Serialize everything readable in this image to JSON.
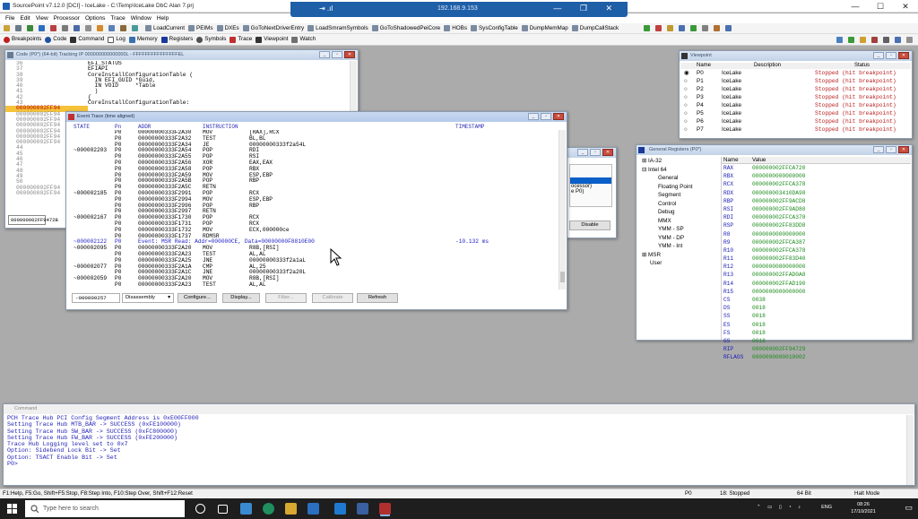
{
  "app": {
    "title": "SourcePoint v7.12.0 [DCI] - IceLake - C:\\Temp\\IceLake DbC Alan 7.prj",
    "controls": [
      "—",
      "☐",
      "✕"
    ]
  },
  "remote": {
    "host": "192.168.9.153",
    "signal": "⇥ .ıl",
    "controls": "— ❐ ✕"
  },
  "menu": [
    "File",
    "Edit",
    "View",
    "Processor",
    "Options",
    "Trace",
    "Window",
    "Help"
  ],
  "toolbar1": {
    "macros": [
      "LoadCurrent",
      "PEIMs",
      "DXEs",
      "GoToNextDriverEntry",
      "LoadSmramSymbols",
      "GoToShadowedPeiCore",
      "HOBs",
      "SysConfigTable",
      "DumpMemMap",
      "DumpCallStack"
    ]
  },
  "toolbar2": {
    "views": [
      "Breakpoints",
      "Code",
      "Command",
      "Log",
      "Memory",
      "Registers",
      "Symbols",
      "Trace",
      "Viewpoint",
      "Watch"
    ]
  },
  "code_window": {
    "title": "Code (P0*) (64-bit) Tracking IP 000000000000000L - FFFFFFFFFFFFFFFEL",
    "lines": [
      {
        "n": "36",
        "t": "EFI_STATUS"
      },
      {
        "n": "37",
        "t": "EFIAPI"
      },
      {
        "n": "38",
        "t": "CoreInstallConfigurationTable ("
      },
      {
        "n": "39",
        "t": "  IN EFI_GUID *Guid,"
      },
      {
        "n": "40",
        "t": "  IN VOID     *Table"
      },
      {
        "n": "41",
        "t": "  )"
      },
      {
        "n": "42",
        "t": "{"
      },
      {
        "n": "43",
        "t": "CoreInstallConfigurationTable:"
      },
      {
        "n": "000000002FF94",
        "t": "",
        "cur": true
      },
      {
        "n": "000000002FF94",
        "t": "",
        "addr": true
      },
      {
        "n": "000000002FF94",
        "t": "",
        "addr": true
      },
      {
        "n": "000000002FF94",
        "t": "",
        "addr": true
      },
      {
        "n": "000000002FF94",
        "t": "",
        "addr": true
      },
      {
        "n": "000000002FF94",
        "t": "",
        "addr": true
      },
      {
        "n": "000000002FF94",
        "t": "",
        "addr": true
      },
      {
        "n": "44",
        "t": ""
      },
      {
        "n": "45",
        "t": ""
      },
      {
        "n": "46",
        "t": ""
      },
      {
        "n": "47",
        "t": ""
      },
      {
        "n": "48",
        "t": ""
      },
      {
        "n": "49",
        "t": ""
      },
      {
        "n": "50",
        "t": ""
      },
      {
        "n": "000000002FF94",
        "t": "",
        "addr": true
      },
      {
        "n": "000000002FF94",
        "t": "",
        "addr": true
      }
    ],
    "address_box": "000000002FF9472B"
  },
  "trace_window": {
    "title": "Event Trace (time aligned)",
    "headers": {
      "state": "STATE",
      "pn": "Pn",
      "addr": "ADDR",
      "instr": "INSTRUCTION",
      "ts": "TIMESTAMP"
    },
    "rows": [
      {
        "s": "",
        "p": "P0",
        "a": "00000000333F2A30",
        "m": "MOV",
        "o": "[RAX],RCX",
        "t": ""
      },
      {
        "s": "",
        "p": "P0",
        "a": "00000000333F2A32",
        "m": "TEST",
        "o": "BL,BL",
        "t": ""
      },
      {
        "s": "",
        "p": "P0",
        "a": "00000000333F2A34",
        "m": "JE",
        "o": "00000000333f2a54L",
        "t": ""
      },
      {
        "s": "~000002203",
        "p": "P0",
        "a": "00000000333F2A54",
        "m": "POP",
        "o": "RDI",
        "t": ""
      },
      {
        "s": "",
        "p": "P0",
        "a": "00000000333F2A55",
        "m": "POP",
        "o": "RSI",
        "t": ""
      },
      {
        "s": "",
        "p": "P0",
        "a": "00000000333F2A56",
        "m": "XOR",
        "o": "EAX,EAX",
        "t": ""
      },
      {
        "s": "",
        "p": "P0",
        "a": "00000000333F2A58",
        "m": "POP",
        "o": "RBX",
        "t": ""
      },
      {
        "s": "",
        "p": "P0",
        "a": "00000000333F2A59",
        "m": "MOV",
        "o": "ESP,EBP",
        "t": ""
      },
      {
        "s": "",
        "p": "P0",
        "a": "00000000333F2A5B",
        "m": "POP",
        "o": "RBP",
        "t": ""
      },
      {
        "s": "",
        "p": "P0",
        "a": "00000000333F2A5C",
        "m": "RETN",
        "o": "",
        "t": ""
      },
      {
        "s": "~000002185",
        "p": "P0",
        "a": "00000000333F2991",
        "m": "POP",
        "o": "RCX",
        "t": ""
      },
      {
        "s": "",
        "p": "P0",
        "a": "00000000333F2994",
        "m": "MOV",
        "o": "ESP,EBP",
        "t": ""
      },
      {
        "s": "",
        "p": "P0",
        "a": "00000000333F2996",
        "m": "POP",
        "o": "RBP",
        "t": ""
      },
      {
        "s": "",
        "p": "P0",
        "a": "00000000333F2997",
        "m": "RETN",
        "o": "",
        "t": ""
      },
      {
        "s": "~000002167",
        "p": "P0",
        "a": "00000000333F1730",
        "m": "POP",
        "o": "RCX",
        "t": ""
      },
      {
        "s": "",
        "p": "P0",
        "a": "00000000333F1731",
        "m": "POP",
        "o": "RCX",
        "t": ""
      },
      {
        "s": "",
        "p": "P0",
        "a": "00000000333F1732",
        "m": "MOV",
        "o": "ECX,000000ce",
        "t": ""
      },
      {
        "s": "",
        "p": "P0",
        "a": "00000000333F1737",
        "m": "RDMSR",
        "o": "",
        "t": ""
      },
      {
        "s": "~000002122",
        "p": "P0",
        "a": "Event: MSR Read: Addr=000000CE, Data=00000000F8810E00",
        "m": "",
        "o": "",
        "t": "-10.132 ms",
        "ev": true
      },
      {
        "s": "~000002095",
        "p": "P0",
        "a": "00000000333F2A20",
        "m": "MOV",
        "o": "R8B,[RSI]",
        "t": ""
      },
      {
        "s": "",
        "p": "P0",
        "a": "00000000333F2A23",
        "m": "TEST",
        "o": "AL,AL",
        "t": ""
      },
      {
        "s": "",
        "p": "P0",
        "a": "00000000333F2A25",
        "m": "JNE",
        "o": "00000000333f2a1aL",
        "t": ""
      },
      {
        "s": "~000002077",
        "p": "P0",
        "a": "00000000333F2A1A",
        "m": "CMP",
        "o": "AL,25",
        "t": ""
      },
      {
        "s": "",
        "p": "P0",
        "a": "00000000333F2A1C",
        "m": "JNE",
        "o": "00000000333f2a20L",
        "t": ""
      },
      {
        "s": "~000002059",
        "p": "P0",
        "a": "00000000333F2A20",
        "m": "MOV",
        "o": "R8B,[RSI]",
        "t": ""
      },
      {
        "s": "",
        "p": "P0",
        "a": "00000000333F2A23",
        "m": "TEST",
        "o": "AL,AL",
        "t": ""
      }
    ],
    "position": "-000000257",
    "view_select": "Disassembly",
    "buttons": {
      "configure": "Configure...",
      "display": "Display...",
      "filter": "Filter...",
      "calibrate": "Calibrate",
      "refresh": "Refresh"
    }
  },
  "viewpoint_window": {
    "title": "Viewpoint",
    "headers": {
      "name": "Name",
      "desc": "Description",
      "status": "Status"
    },
    "rows": [
      {
        "sel": "◉",
        "name": "P0",
        "desc": "IceLake",
        "status": "Stopped (hit breakpoint)"
      },
      {
        "sel": "○",
        "name": "P1",
        "desc": "IceLake",
        "status": "Stopped (hit breakpoint)"
      },
      {
        "sel": "○",
        "name": "P2",
        "desc": "IceLake",
        "status": "Stopped (hit breakpoint)"
      },
      {
        "sel": "○",
        "name": "P3",
        "desc": "IceLake",
        "status": "Stopped (hit breakpoint)"
      },
      {
        "sel": "○",
        "name": "P4",
        "desc": "IceLake",
        "status": "Stopped (hit breakpoint)"
      },
      {
        "sel": "○",
        "name": "P5",
        "desc": "IceLake",
        "status": "Stopped (hit breakpoint)"
      },
      {
        "sel": "○",
        "name": "P6",
        "desc": "IceLake",
        "status": "Stopped (hit breakpoint)"
      },
      {
        "sel": "○",
        "name": "P7",
        "desc": "IceLake",
        "status": "Stopped (hit breakpoint)"
      }
    ]
  },
  "hidden_window": {
    "text1": "ocessor)",
    "text2": "e P0)",
    "disable": "Disable"
  },
  "register_window": {
    "title": "General Registers (P0*)",
    "tree": [
      {
        "label": "⊞ IA-32",
        "indent": 0
      },
      {
        "label": "⊟ Intel 64",
        "indent": 0
      },
      {
        "label": "General",
        "indent": 2
      },
      {
        "label": "Floating Point",
        "indent": 2
      },
      {
        "label": "Segment",
        "indent": 2
      },
      {
        "label": "Control",
        "indent": 2
      },
      {
        "label": "Debug",
        "indent": 2
      },
      {
        "label": "MMX",
        "indent": 2
      },
      {
        "label": "YMM - SP",
        "indent": 2
      },
      {
        "label": "YMM - DP",
        "indent": 2
      },
      {
        "label": "YMM - Int",
        "indent": 2
      },
      {
        "label": "⊞ MSR",
        "indent": 0
      },
      {
        "label": "User",
        "indent": 1
      }
    ],
    "headers": {
      "name": "Name",
      "value": "Value"
    },
    "regs": [
      {
        "n": "RAX",
        "v": "000000002FFCA720"
      },
      {
        "n": "RBX",
        "v": "0000000000000000"
      },
      {
        "n": "RCX",
        "v": "000000002FFCA378"
      },
      {
        "n": "RDX",
        "v": "000000003410DA98"
      },
      {
        "n": "RBP",
        "v": "000000002FF9ACD8"
      },
      {
        "n": "RSI",
        "v": "000000002FF9AD80"
      },
      {
        "n": "RDI",
        "v": "000000002FFCA378"
      },
      {
        "n": "RSP",
        "v": "000000002FF83DD8"
      },
      {
        "n": "R8",
        "v": "0000000000000000"
      },
      {
        "n": "R9",
        "v": "000000002FFCA387"
      },
      {
        "n": "R10",
        "v": "000000002FFCA378"
      },
      {
        "n": "R11",
        "v": "000000002FF83D40"
      },
      {
        "n": "R12",
        "v": "0000000080000000"
      },
      {
        "n": "R13",
        "v": "000000002FFAD0A8"
      },
      {
        "n": "R14",
        "v": "000000002FFAD190"
      },
      {
        "n": "R15",
        "v": "0000000000000000"
      },
      {
        "n": "CS",
        "v": "0038"
      },
      {
        "n": "DS",
        "v": "0018"
      },
      {
        "n": "SS",
        "v": "0018"
      },
      {
        "n": "ES",
        "v": "0018"
      },
      {
        "n": "FS",
        "v": "0018"
      },
      {
        "n": "GS",
        "v": "0018"
      },
      {
        "n": "RIP",
        "v": "000000002FF94729"
      },
      {
        "n": "RFLAGS",
        "v": "0000000000010002"
      }
    ]
  },
  "command_window": {
    "title": "Command",
    "lines": [
      "PCH Trace Hub PCI Config Segment Address is 0xE00FF000",
      "Setting Trace Hub MTB_BAR -> SUCCESS (0xFE100000)",
      "Setting Trace Hub SW_BAR -> SUCCESS (0xFC800000)",
      "Setting Trace Hub FW_BAR -> SUCCESS (0xFE200000)",
      "Trace Hub Logging level set to 0x7",
      "Option: Sidebend Lock Bit -> Set",
      "Option: TSACT Enable Bit -> Set",
      "P0>"
    ]
  },
  "status_bar": {
    "hint": "F1:Help, F5:Go, Shift+F5:Stop, F8:Step Into, F10:Step Over, Shift+F12:Reset",
    "proc": "P0",
    "state": "18: Stopped",
    "bits": "64 Bit",
    "mode": "Halt Mode"
  },
  "taskbar": {
    "search_placeholder": "Type here to search",
    "lang": "ENG",
    "time": "08:26",
    "date": "17/10/2021"
  }
}
